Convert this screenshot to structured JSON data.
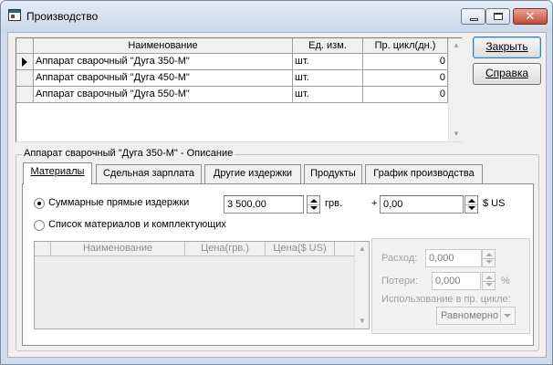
{
  "window": {
    "title": "Производство",
    "close_glyph": "✕"
  },
  "buttons": {
    "close": "Закрыть",
    "help": "Справка"
  },
  "products_table": {
    "columns": [
      "Наименование",
      "Ед. изм.",
      "Пр. цикл(дн.)"
    ],
    "rows": [
      {
        "name": "Аппарат сварочный \"Дуга 350-М\"",
        "unit": "шт.",
        "cycle": "0"
      },
      {
        "name": "Аппарат сварочный \"Дуга 450-М\"",
        "unit": "шт.",
        "cycle": "0"
      },
      {
        "name": "Аппарат сварочный \"Дуга 550-М\"",
        "unit": "шт.",
        "cycle": "0"
      }
    ],
    "selected_row": 0
  },
  "description": {
    "caption": "Аппарат сварочный \"Дуга 350-М\" - Описание",
    "tabs": [
      {
        "label": "Материалы",
        "active": true
      },
      {
        "label": "Сдельная зарплата",
        "active": false
      },
      {
        "label": "Другие издержки",
        "active": false
      },
      {
        "label": "Продукты",
        "active": false
      },
      {
        "label": "График производства",
        "active": false
      }
    ]
  },
  "materials": {
    "option_total": "Суммарные прямые издержки",
    "option_list": "Список материалов и комплектующих",
    "selected_option": "total",
    "amount_uah": "3 500,00",
    "currency_uah": "грв.",
    "plus": "+",
    "amount_usd": "0,00",
    "currency_usd": "$ US",
    "list_columns": [
      "Наименование",
      "Цена(грв.)",
      "Цена($ US)"
    ]
  },
  "usage_panel": {
    "consumption_label": "Расход:",
    "consumption_value": "0,000",
    "losses_label": "Потери:",
    "losses_value": "0,000",
    "percent": "%",
    "usage_label": "Использование в пр. цикле:",
    "usage_value": "Равномерно"
  }
}
